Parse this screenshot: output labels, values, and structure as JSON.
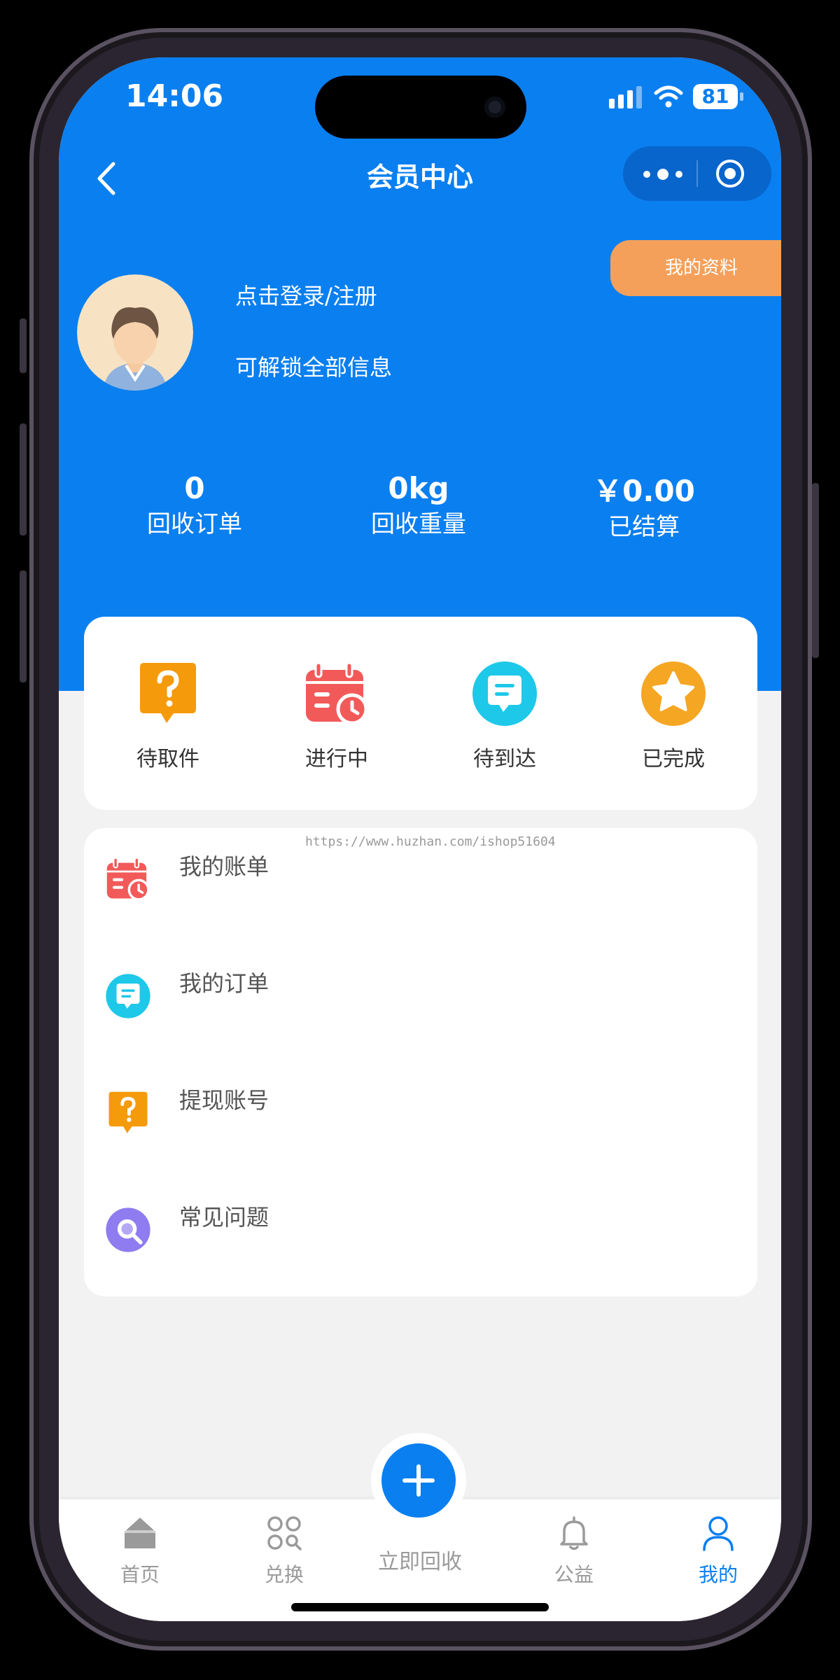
{
  "status_bar": {
    "time": "14:06",
    "battery": "81"
  },
  "nav": {
    "title": "会员中心"
  },
  "profile": {
    "my_info_button": "我的资料",
    "login_text": "点击登录/注册",
    "unlock_text": "可解锁全部信息"
  },
  "stats": [
    {
      "value": "0",
      "label": "回收订单"
    },
    {
      "value": "0kg",
      "label": "回收重量"
    },
    {
      "value": "￥0.00",
      "label": "已结算"
    }
  ],
  "order_status": [
    {
      "label": "待取件",
      "icon": "question-bubble-icon"
    },
    {
      "label": "进行中",
      "icon": "calendar-clock-icon"
    },
    {
      "label": "待到达",
      "icon": "message-icon"
    },
    {
      "label": "已完成",
      "icon": "star-icon"
    }
  ],
  "watermark": "https://www.huzhan.com/ishop51604",
  "menu": [
    {
      "label": "我的账单",
      "icon": "calendar-clock-icon"
    },
    {
      "label": "我的订单",
      "icon": "message-icon"
    },
    {
      "label": "提现账号",
      "icon": "question-bubble-icon"
    },
    {
      "label": "常见问题",
      "icon": "search-icon"
    }
  ],
  "tabbar": [
    {
      "label": "首页",
      "icon": "home-icon"
    },
    {
      "label": "兑换",
      "icon": "grid-icon"
    },
    {
      "label": "立即回收",
      "icon": "plus-icon"
    },
    {
      "label": "公益",
      "icon": "bell-icon"
    },
    {
      "label": "我的",
      "icon": "user-icon"
    }
  ],
  "colors": {
    "primary": "#0a7ff0",
    "accent": "#f5a05a",
    "orange": "#f59a0b",
    "red": "#f25a5a",
    "cyan": "#1ec8e8",
    "purple": "#8e7cf0"
  }
}
